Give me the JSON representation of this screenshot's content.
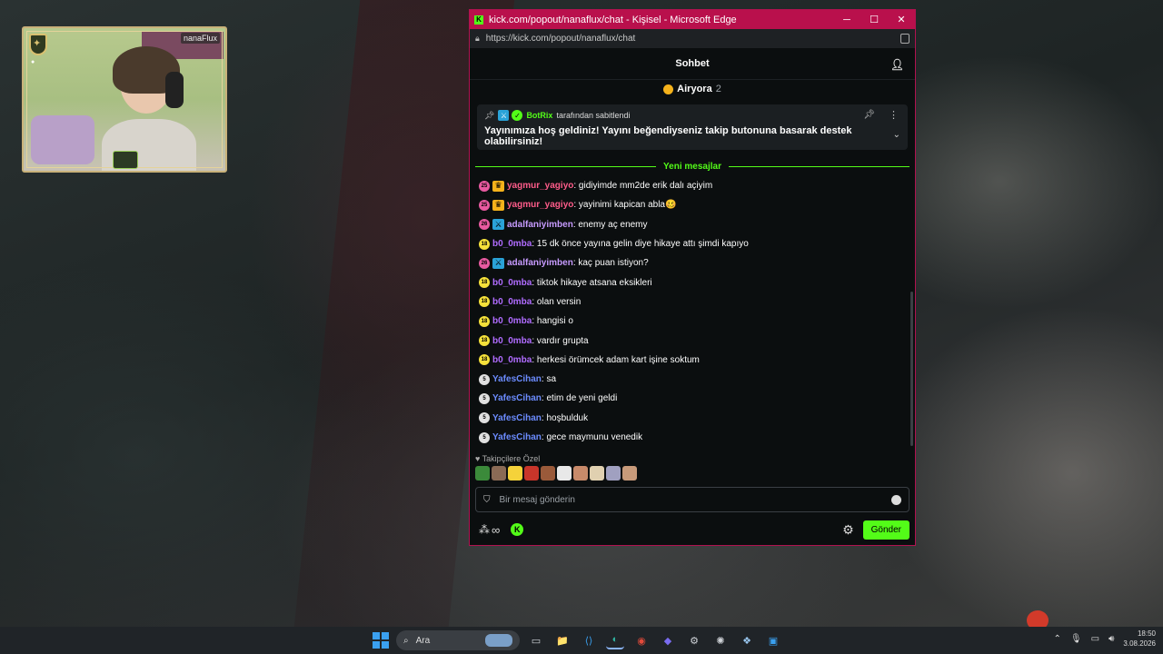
{
  "window": {
    "title": "kick.com/popout/nanaflux/chat - Kişisel - Microsoft Edge",
    "url": "https://kick.com/popout/nanaflux/chat",
    "controls": {
      "minimize": "─",
      "maximize": "☐",
      "close": "✕"
    }
  },
  "webcam": {
    "name_tag": "nanaFlux"
  },
  "chat": {
    "header_title": "Sohbet",
    "goal_label": "Airyora",
    "goal_count": "2",
    "pinned": {
      "pinned_by_user": "BotRix",
      "pinned_by_suffix": "tarafından sabitlendi",
      "message": "Yayınımıza hoş geldiniz! Yayını beğendiyseniz takip butonuna basarak destek olabilirsiniz!"
    },
    "new_messages_label": "Yeni mesajlar",
    "messages": [
      {
        "level": "25",
        "level_color": "#e85aa0",
        "sub_icon": "♛",
        "sub_color": "#f5b21b",
        "user": "yagmur_yagiyo",
        "user_color": "#ff5c8a",
        "text": ": gidiyimde mm2de erik dalı açiyim"
      },
      {
        "level": "25",
        "level_color": "#e85aa0",
        "sub_icon": "♛",
        "sub_color": "#f5b21b",
        "user": "yagmur_yagiyo",
        "user_color": "#ff5c8a",
        "text": ": yayinimi kapican abla🥴"
      },
      {
        "level": "26",
        "level_color": "#e85aa0",
        "sub_icon": "⚔",
        "sub_color": "#2aa3d8",
        "user": "adalfaniyimben",
        "user_color": "#c79bff",
        "text": ": enemy aç enemy"
      },
      {
        "level": "18",
        "level_color": "#f5e13a",
        "sub_icon": "",
        "sub_color": "",
        "user": "b0_0mba",
        "user_color": "#b06cff",
        "text": ": 15 dk önce yayına gelin diye hikaye attı şimdi kapıyo"
      },
      {
        "level": "26",
        "level_color": "#e85aa0",
        "sub_icon": "⚔",
        "sub_color": "#2aa3d8",
        "user": "adalfaniyimben",
        "user_color": "#c79bff",
        "text": ": kaç puan istiyon?"
      },
      {
        "level": "18",
        "level_color": "#f5e13a",
        "sub_icon": "",
        "sub_color": "",
        "user": "b0_0mba",
        "user_color": "#b06cff",
        "text": ": tiktok hikaye atsana eksikleri"
      },
      {
        "level": "18",
        "level_color": "#f5e13a",
        "sub_icon": "",
        "sub_color": "",
        "user": "b0_0mba",
        "user_color": "#b06cff",
        "text": ": olan versin"
      },
      {
        "level": "18",
        "level_color": "#f5e13a",
        "sub_icon": "",
        "sub_color": "",
        "user": "b0_0mba",
        "user_color": "#b06cff",
        "text": ": hangisi o"
      },
      {
        "level": "18",
        "level_color": "#f5e13a",
        "sub_icon": "",
        "sub_color": "",
        "user": "b0_0mba",
        "user_color": "#b06cff",
        "text": ": vardır grupta"
      },
      {
        "level": "18",
        "level_color": "#f5e13a",
        "sub_icon": "",
        "sub_color": "",
        "user": "b0_0mba",
        "user_color": "#b06cff",
        "text": ": herkesi örümcek adam kart işine soktum"
      },
      {
        "level": "5",
        "level_color": "#e0e0e0",
        "sub_icon": "",
        "sub_color": "",
        "user": "YafesCihan",
        "user_color": "#6c8cff",
        "text": ": sa"
      },
      {
        "level": "5",
        "level_color": "#e0e0e0",
        "sub_icon": "",
        "sub_color": "",
        "user": "YafesCihan",
        "user_color": "#6c8cff",
        "text": ": etim de yeni geldi"
      },
      {
        "level": "5",
        "level_color": "#e0e0e0",
        "sub_icon": "",
        "sub_color": "",
        "user": "YafesCihan",
        "user_color": "#6c8cff",
        "text": ": hoşbulduk"
      },
      {
        "level": "5",
        "level_color": "#e0e0e0",
        "sub_icon": "",
        "sub_color": "",
        "user": "YafesCihan",
        "user_color": "#6c8cff",
        "text": ": gece maymunu venedik"
      }
    ],
    "emote_section_label": "♥ Takipçilere Özel",
    "emote_colors": [
      "#3b8a3a",
      "#8a6a55",
      "#f5d23a",
      "#c8352a",
      "#9a5a3a",
      "#e8e8e8",
      "#c88a6a",
      "#e0d0b0",
      "#a0a0c0",
      "#c89a7a"
    ],
    "input_placeholder": "Bir mesaj gönderin",
    "send_label": "Gönder"
  },
  "taskbar": {
    "search_placeholder": "Ara",
    "apps": [
      {
        "name": "task-view",
        "glyph": "▭",
        "color": "#cfd3d8"
      },
      {
        "name": "file-explorer",
        "glyph": "📁",
        "color": "#f5c542"
      },
      {
        "name": "vscode",
        "glyph": "⟨⟩",
        "color": "#3aa0f0"
      },
      {
        "name": "edge",
        "glyph": "◐",
        "color": "#2fb3a0"
      },
      {
        "name": "chrome",
        "glyph": "◉",
        "color": "#e24a3a"
      },
      {
        "name": "app-diamond",
        "glyph": "◆",
        "color": "#7a6cf0"
      },
      {
        "name": "settings",
        "glyph": "⚙",
        "color": "#cfd3d8"
      },
      {
        "name": "app-gear",
        "glyph": "✺",
        "color": "#cfd3d8"
      },
      {
        "name": "app-bubble",
        "glyph": "❖",
        "color": "#9ac8f0"
      },
      {
        "name": "app-photos",
        "glyph": "▣",
        "color": "#3aa0f0"
      }
    ],
    "time": "18:50",
    "date": "3.08.2026"
  }
}
